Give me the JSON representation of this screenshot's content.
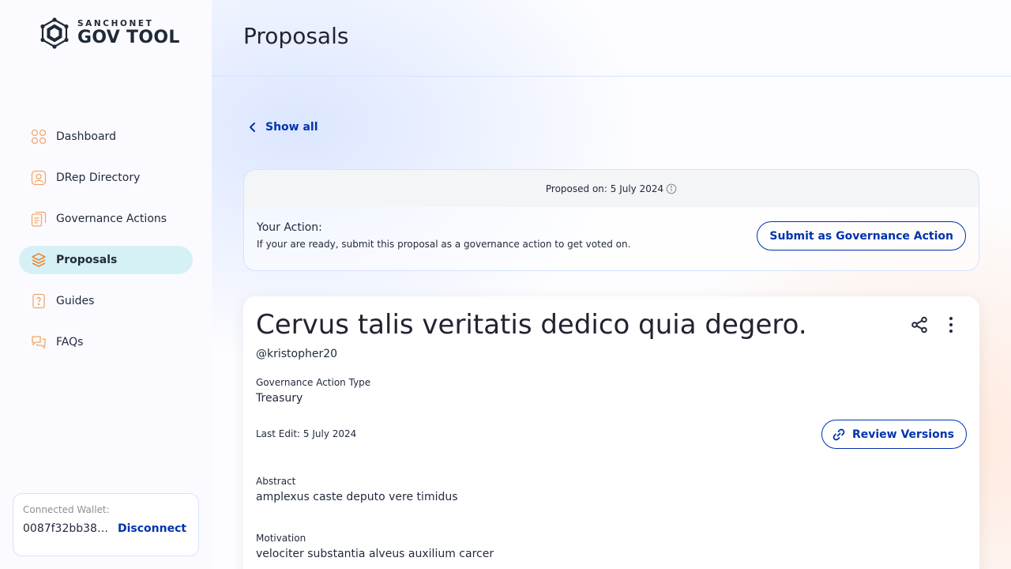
{
  "brand": {
    "small": "SANCHONET",
    "big": "GOV TOOL"
  },
  "nav": {
    "items": [
      {
        "label": "Dashboard",
        "icon": "dashboard-icon"
      },
      {
        "label": "DRep Directory",
        "icon": "drep-directory-icon"
      },
      {
        "label": "Governance Actions",
        "icon": "governance-actions-icon"
      },
      {
        "label": "Proposals",
        "icon": "proposals-icon",
        "active": true
      },
      {
        "label": "Guides",
        "icon": "guides-icon"
      },
      {
        "label": "FAQs",
        "icon": "faqs-icon"
      }
    ]
  },
  "wallet": {
    "label": "Connected Wallet:",
    "address": "0087f32bb38a...",
    "disconnect": "Disconnect"
  },
  "header": {
    "title": "Proposals"
  },
  "back": {
    "label": "Show all"
  },
  "action_card": {
    "proposed_on": "Proposed on: 5 July 2024",
    "your_action": "Your Action:",
    "description": "If your are ready, submit this proposal as a governance action to get voted on.",
    "submit_label": "Submit as Governance Action"
  },
  "proposal": {
    "title": "Cervus talis veritatis dedico quia degero.",
    "author": "@kristopher20",
    "type_label": "Governance Action Type",
    "type_value": "Treasury",
    "last_edit": "Last Edit: 5 July 2024",
    "review_label": "Review Versions",
    "abstract_label": "Abstract",
    "abstract_value": "amplexus caste deputo vere timidus",
    "motivation_label": "Motivation",
    "motivation_value": "velociter substantia alveus auxilium carcer"
  },
  "colors": {
    "primary": "#0033AD",
    "active_nav": "#D6F1F5",
    "border": "#D6E2FF",
    "icon_orange": "#F3A66B"
  }
}
